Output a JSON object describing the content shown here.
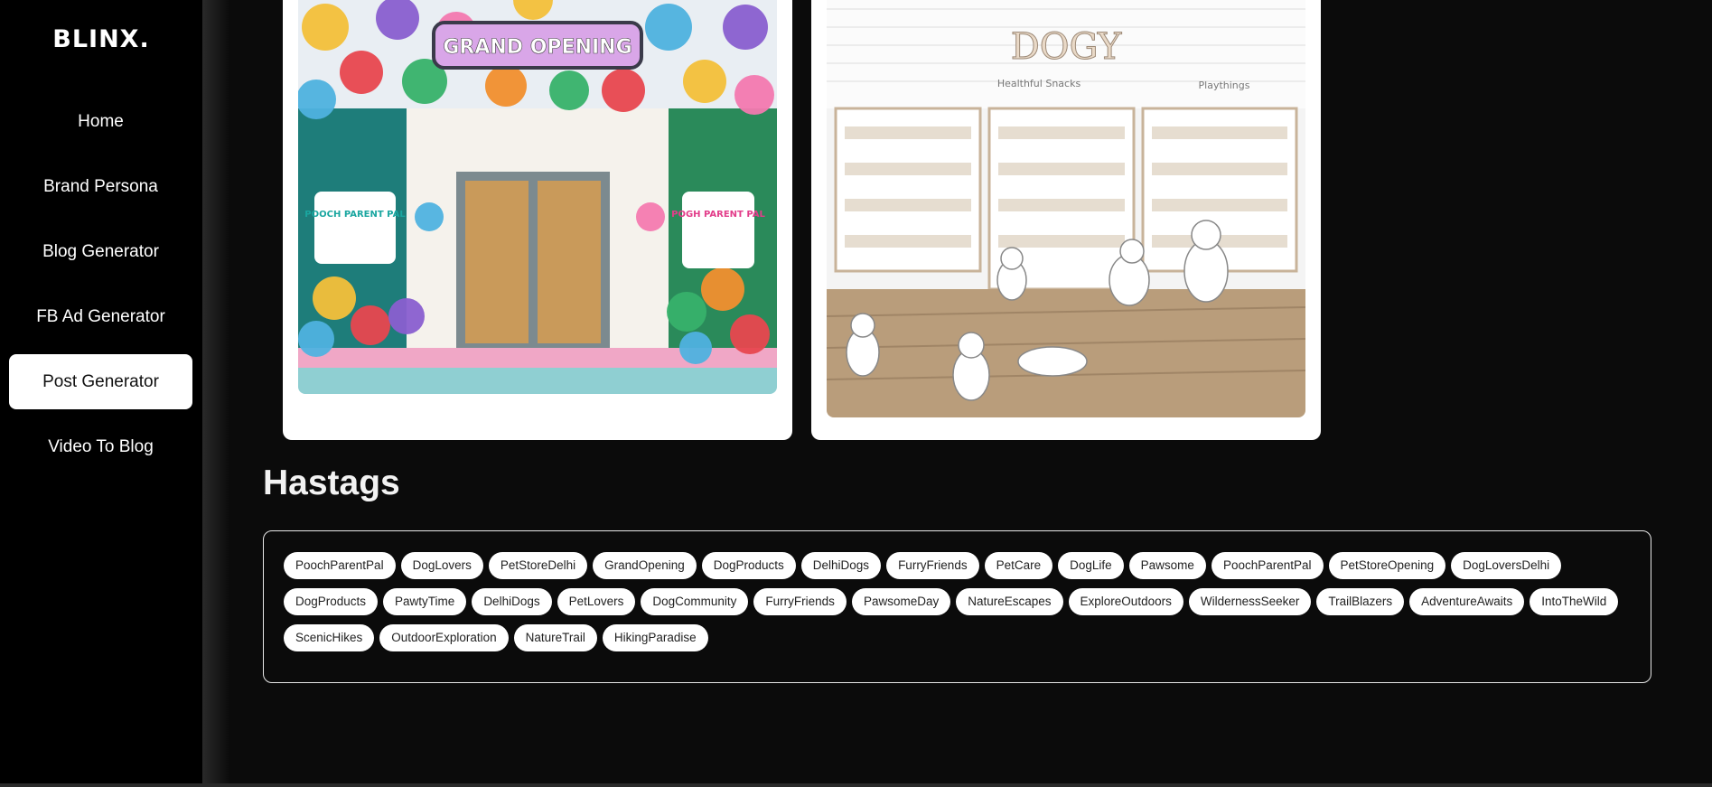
{
  "brand": {
    "logo_text": "BLINX."
  },
  "sidebar": {
    "items": [
      {
        "label": "Home",
        "active": false
      },
      {
        "label": "Brand Persona",
        "active": false
      },
      {
        "label": "Blog Generator",
        "active": false
      },
      {
        "label": "FB Ad Generator",
        "active": false
      },
      {
        "label": "Post Generator",
        "active": true
      },
      {
        "label": "Video To Blog",
        "active": false
      }
    ]
  },
  "images": {
    "first_banner": "GRAND OPENING",
    "first_sign_left": "POOCH PARENT PAL",
    "first_sign_right": "POGH PARENT PAL",
    "second_sign": "DOGY",
    "second_label_left": "Healthful Snacks",
    "second_label_right": "Playthings"
  },
  "hashtags": {
    "title": "Hastags",
    "tags": [
      "PoochParentPal",
      "DogLovers",
      "PetStoreDelhi",
      "GrandOpening",
      "DogProducts",
      "DelhiDogs",
      "FurryFriends",
      "PetCare",
      "DogLife",
      "Pawsome",
      "PoochParentPal",
      "PetStoreOpening",
      "DogLoversDelhi",
      "DogProducts",
      "PawtyTime",
      "DelhiDogs",
      "PetLovers",
      "DogCommunity",
      "FurryFriends",
      "PawsomeDay",
      "NatureEscapes",
      "ExploreOutdoors",
      "WildernessSeeker",
      "TrailBlazers",
      "AdventureAwaits",
      "IntoTheWild",
      "ScenicHikes",
      "OutdoorExploration",
      "NatureTrail",
      "HikingParadise"
    ]
  }
}
